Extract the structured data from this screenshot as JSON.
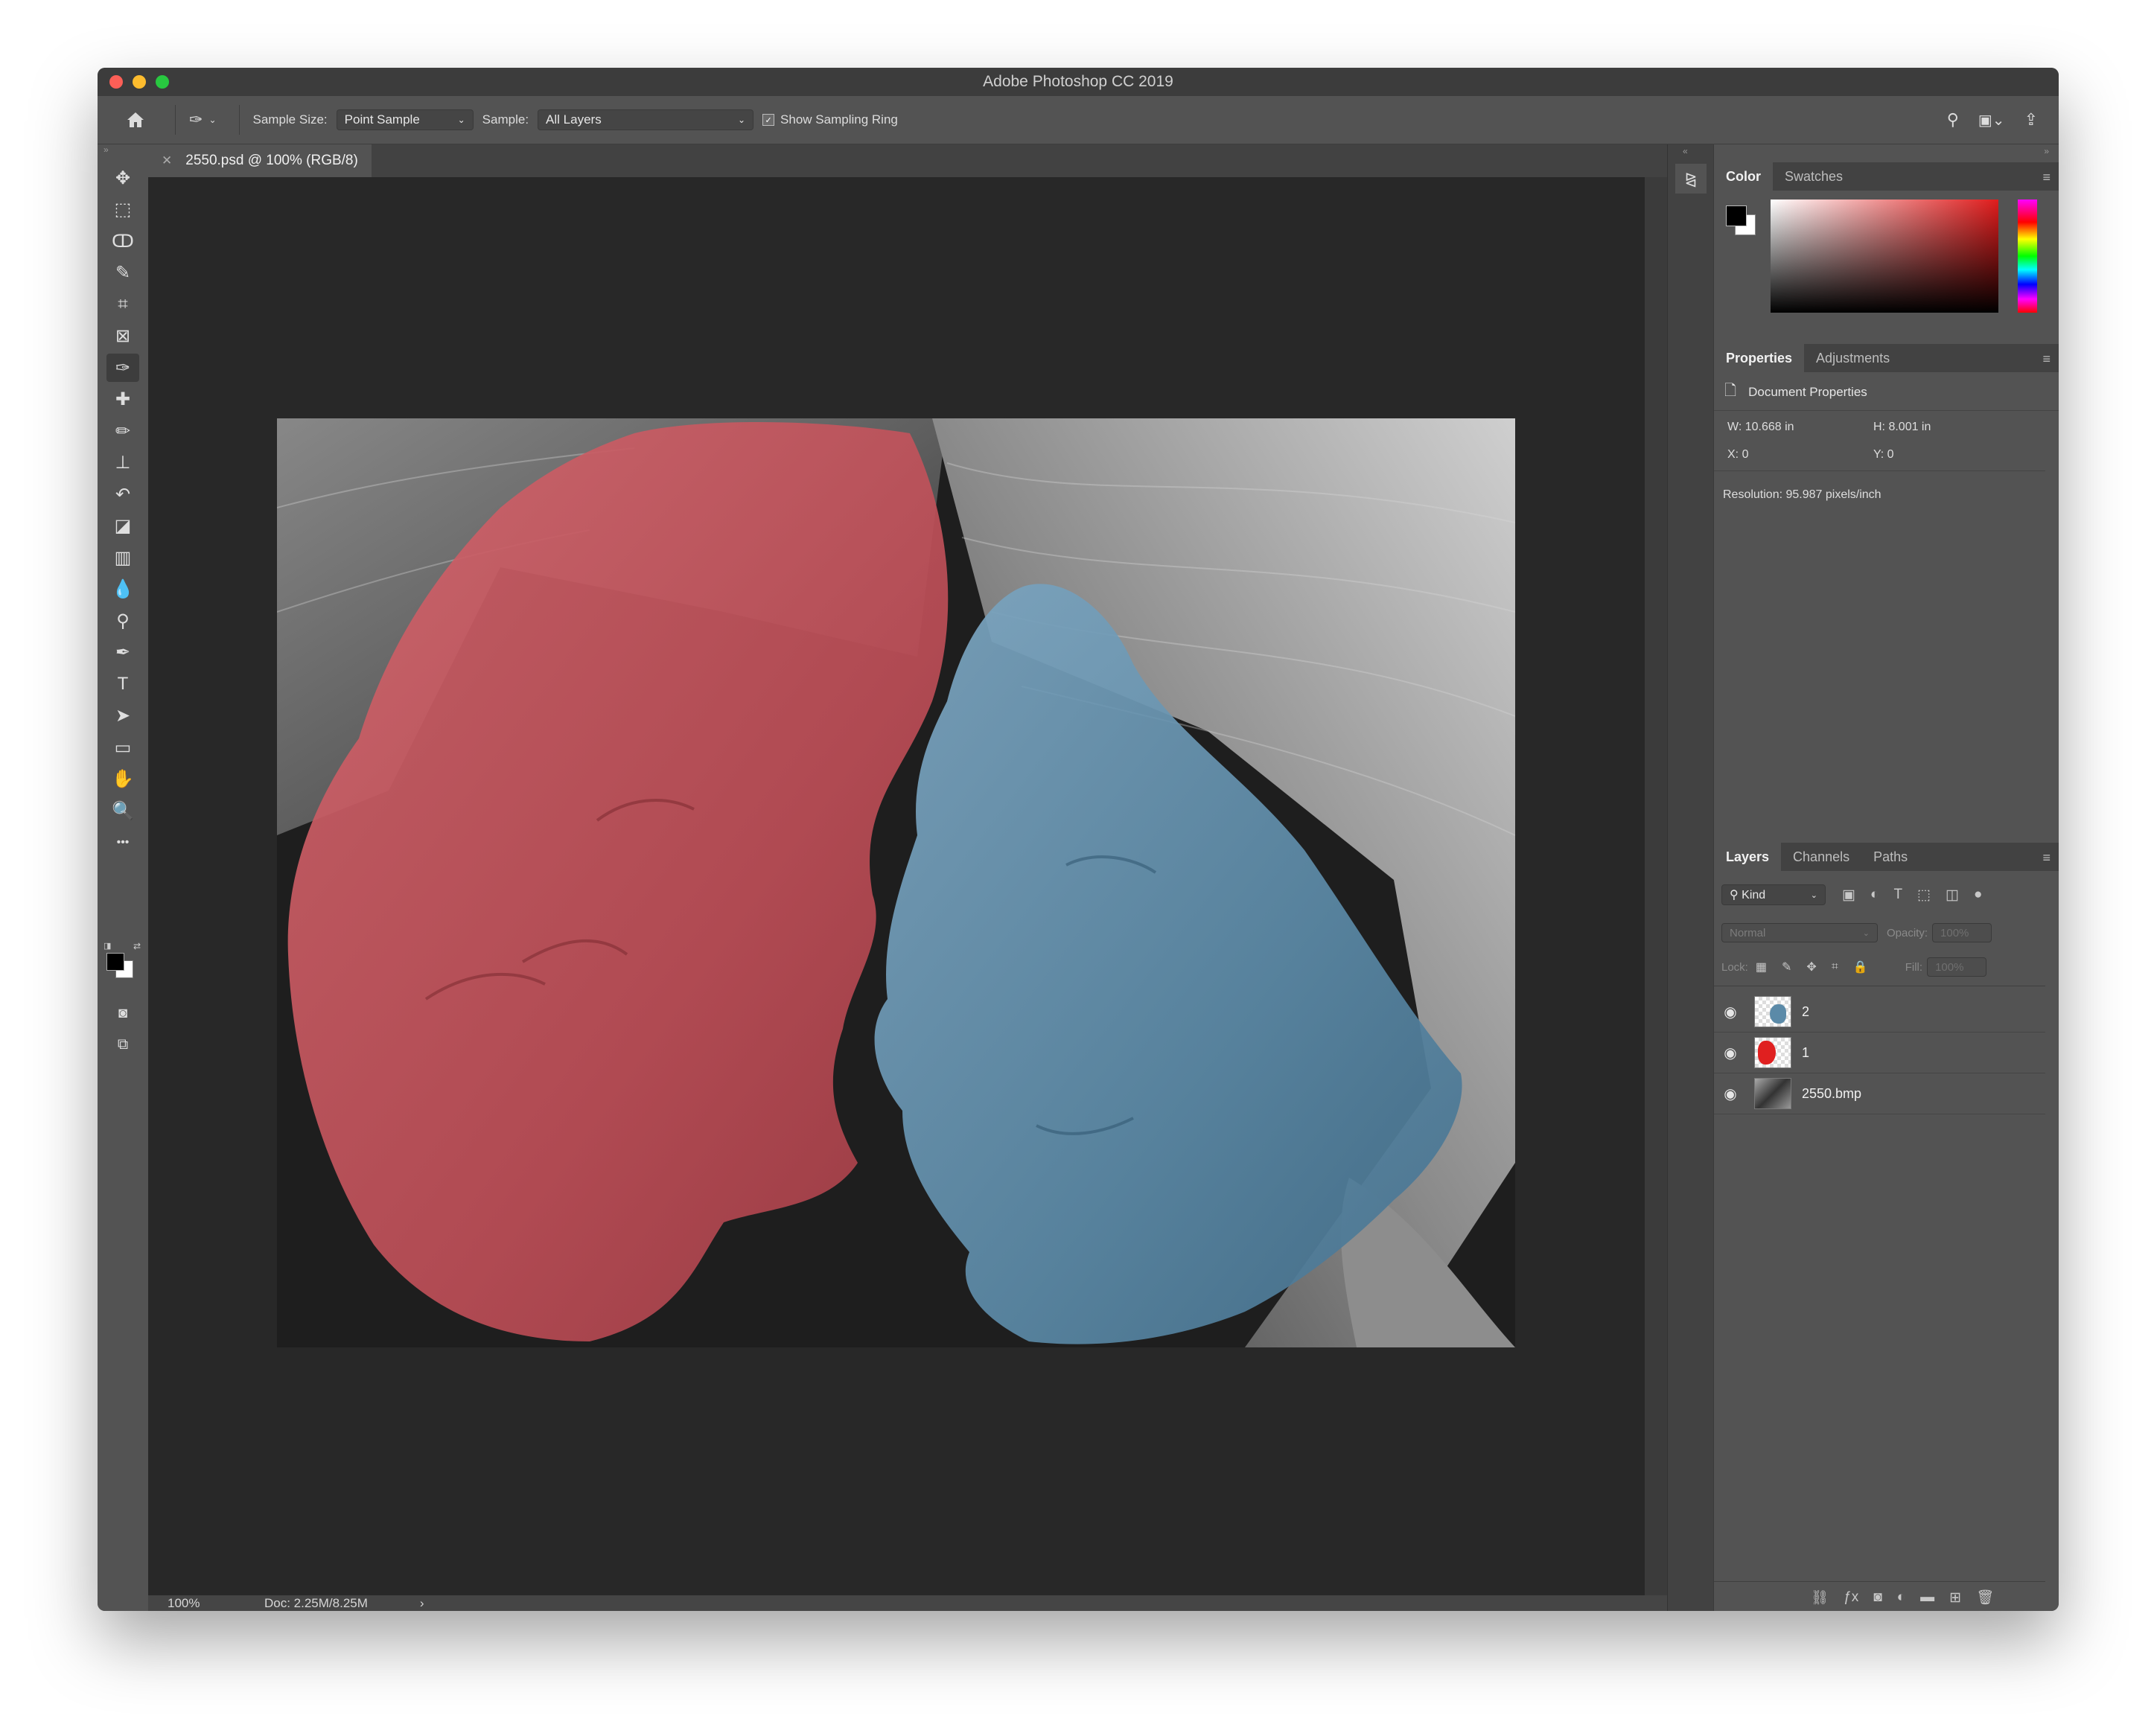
{
  "app": {
    "title": "Adobe Photoshop CC 2019"
  },
  "window_controls": {
    "close": "close",
    "minimize": "minimize",
    "zoom": "zoom"
  },
  "options_bar": {
    "home_icon": "home-icon",
    "tool_icon": "eyedropper-icon",
    "sample_size_label": "Sample Size:",
    "sample_size_value": "Point Sample",
    "sample_label": "Sample:",
    "sample_value": "All Layers",
    "show_sampling_ring_label": "Show Sampling Ring",
    "show_sampling_ring_checked": true
  },
  "document": {
    "tab_title": "2550.psd @ 100% (RGB/8)",
    "zoom": "100%",
    "doc_size": "Doc: 2.25M/8.25M",
    "status_arrow": "›"
  },
  "toolbar": {
    "tools": [
      {
        "name": "move-tool",
        "glyph": "✥"
      },
      {
        "name": "marquee-tool",
        "glyph": "⬚"
      },
      {
        "name": "lasso-tool",
        "glyph": "ↀ"
      },
      {
        "name": "quick-selection-tool",
        "glyph": "✎"
      },
      {
        "name": "crop-tool",
        "glyph": "⌗"
      },
      {
        "name": "frame-tool",
        "glyph": "⊠"
      },
      {
        "name": "eyedropper-tool",
        "glyph": "✑"
      },
      {
        "name": "healing-brush-tool",
        "glyph": "✚"
      },
      {
        "name": "brush-tool",
        "glyph": "✏"
      },
      {
        "name": "clone-stamp-tool",
        "glyph": "⊥"
      },
      {
        "name": "history-brush-tool",
        "glyph": "↶"
      },
      {
        "name": "eraser-tool",
        "glyph": "◪"
      },
      {
        "name": "gradient-tool",
        "glyph": "▥"
      },
      {
        "name": "blur-tool",
        "glyph": "💧"
      },
      {
        "name": "dodge-tool",
        "glyph": "⚲"
      },
      {
        "name": "pen-tool",
        "glyph": "✒"
      },
      {
        "name": "type-tool",
        "glyph": "T"
      },
      {
        "name": "path-selection-tool",
        "glyph": "➤"
      },
      {
        "name": "rectangle-tool",
        "glyph": "▭"
      },
      {
        "name": "hand-tool",
        "glyph": "✋"
      },
      {
        "name": "zoom-tool",
        "glyph": "🔍"
      },
      {
        "name": "more-tools",
        "glyph": "•••"
      }
    ]
  },
  "color_panel": {
    "tabs": [
      "Color",
      "Swatches"
    ]
  },
  "properties_panel": {
    "tabs": [
      "Properties",
      "Adjustments"
    ],
    "header": "Document Properties",
    "w": "W: 10.668 in",
    "h": "H: 8.001 in",
    "x": "X: 0",
    "y": "Y: 0",
    "resolution": "Resolution: 95.987 pixels/inch"
  },
  "layers_panel": {
    "tabs": [
      "Layers",
      "Channels",
      "Paths"
    ],
    "filter_kind": "Kind",
    "blend_mode": "Normal",
    "opacity_label": "Opacity:",
    "opacity_value": "100%",
    "lock_label": "Lock:",
    "fill_label": "Fill:",
    "fill_value": "100%",
    "layers": [
      {
        "name": "2",
        "visible": true,
        "thumb": "blue-mask"
      },
      {
        "name": "1",
        "visible": true,
        "thumb": "red-mask"
      },
      {
        "name": "2550.bmp",
        "visible": true,
        "thumb": "photo"
      }
    ]
  },
  "colors": {
    "red_overlay": "#c5545c",
    "blue_overlay": "#5b8aa8",
    "foreground": "#000000",
    "background": "#ffffff"
  }
}
